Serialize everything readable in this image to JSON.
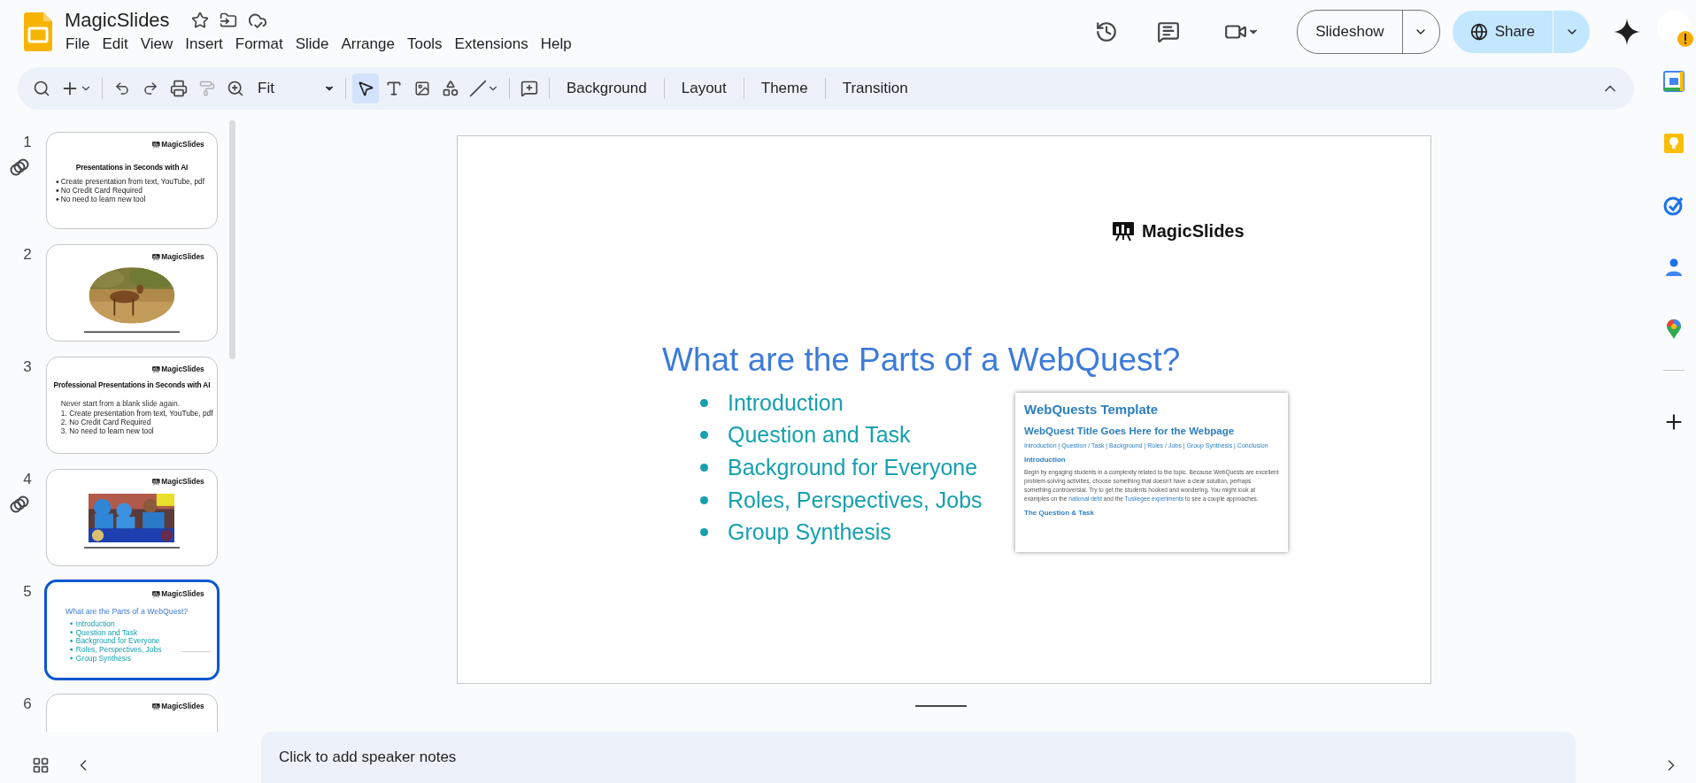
{
  "document": {
    "title": "MagicSlides"
  },
  "menu": [
    {
      "label": "File"
    },
    {
      "label": "Edit"
    },
    {
      "label": "View"
    },
    {
      "label": "Insert"
    },
    {
      "label": "Format"
    },
    {
      "label": "Slide"
    },
    {
      "label": "Arrange"
    },
    {
      "label": "Tools"
    },
    {
      "label": "Extensions"
    },
    {
      "label": "Help"
    }
  ],
  "header": {
    "slideshow": "Slideshow",
    "share": "Share"
  },
  "toolbar": {
    "zoom": "Fit",
    "actions": [
      {
        "label": "Background"
      },
      {
        "label": "Layout"
      },
      {
        "label": "Theme"
      },
      {
        "label": "Transition"
      }
    ]
  },
  "slides": [
    {
      "number": "1",
      "selected": false,
      "linked": true,
      "kind": "bullets",
      "logo": "MagicSlides",
      "title": "Presentations in Seconds with AI",
      "bullets": [
        "Create presentation from text, YouTube, pdf",
        "No Credit Card Required",
        "No need to learn new tool"
      ]
    },
    {
      "number": "2",
      "selected": false,
      "linked": false,
      "kind": "oval-picture",
      "logo": "MagicSlides"
    },
    {
      "number": "3",
      "selected": false,
      "linked": false,
      "kind": "numbered",
      "logo": "MagicSlides",
      "title": "Professional Presentations in Seconds with AI",
      "subtitle": "Never start from a blank slide again.",
      "items": [
        {
          "marker": "1.",
          "text": "Create presentation from text, YouTube, pdf"
        },
        {
          "marker": "2.",
          "text": "No Credit Card Required"
        },
        {
          "marker": "3.",
          "text": "No need to learn new tool"
        }
      ]
    },
    {
      "number": "4",
      "selected": false,
      "linked": true,
      "kind": "wide-picture",
      "logo": "MagicSlides"
    },
    {
      "number": "5",
      "selected": true,
      "linked": false,
      "kind": "webquest",
      "logo": "MagicSlides",
      "title": "What are the Parts of a WebQuest?",
      "bullets": [
        "Introduction",
        "Question and Task",
        "Background for Everyone",
        "Roles, Perspectives, Jobs",
        "Group Synthesis"
      ]
    },
    {
      "number": "6",
      "selected": false,
      "linked": false,
      "kind": "logo-only",
      "logo": "MagicSlides"
    }
  ],
  "editor_slide": {
    "kind": "webquest",
    "logo": "MagicSlides",
    "title": "What are the Parts of a WebQuest?",
    "bullets": [
      "Introduction",
      "Question and Task",
      "Background for Everyone",
      "Roles, Perspectives, Jobs",
      "Group Synthesis"
    ],
    "document": {
      "title": "WebQuests Template",
      "subtitle": "WebQuest Title Goes Here for the Webpage",
      "nav": "Introduction | Question / Task | Background | Roles / Jobs | Group Synthesis |  Conclusion",
      "section": "Introduction",
      "paragraph": [
        {
          "kind": "text",
          "text": "Begin by engaging students in a complexity related to the topic. Because WebQuests are excellent problem-solving activities, choose something that doesn't have a clear solution, perhaps something controversial. Try to get the students hooked and wondering. You might look at examples on the "
        },
        {
          "kind": "link",
          "text": "national debt"
        },
        {
          "kind": "text",
          "text": " and the "
        },
        {
          "kind": "link",
          "text": "Tuskegee experiments"
        },
        {
          "kind": "text",
          "text": " to see a couple approaches."
        }
      ],
      "next_section": "The Question & Task"
    }
  },
  "speaker_notes": {
    "placeholder": "Click to add speaker notes"
  }
}
